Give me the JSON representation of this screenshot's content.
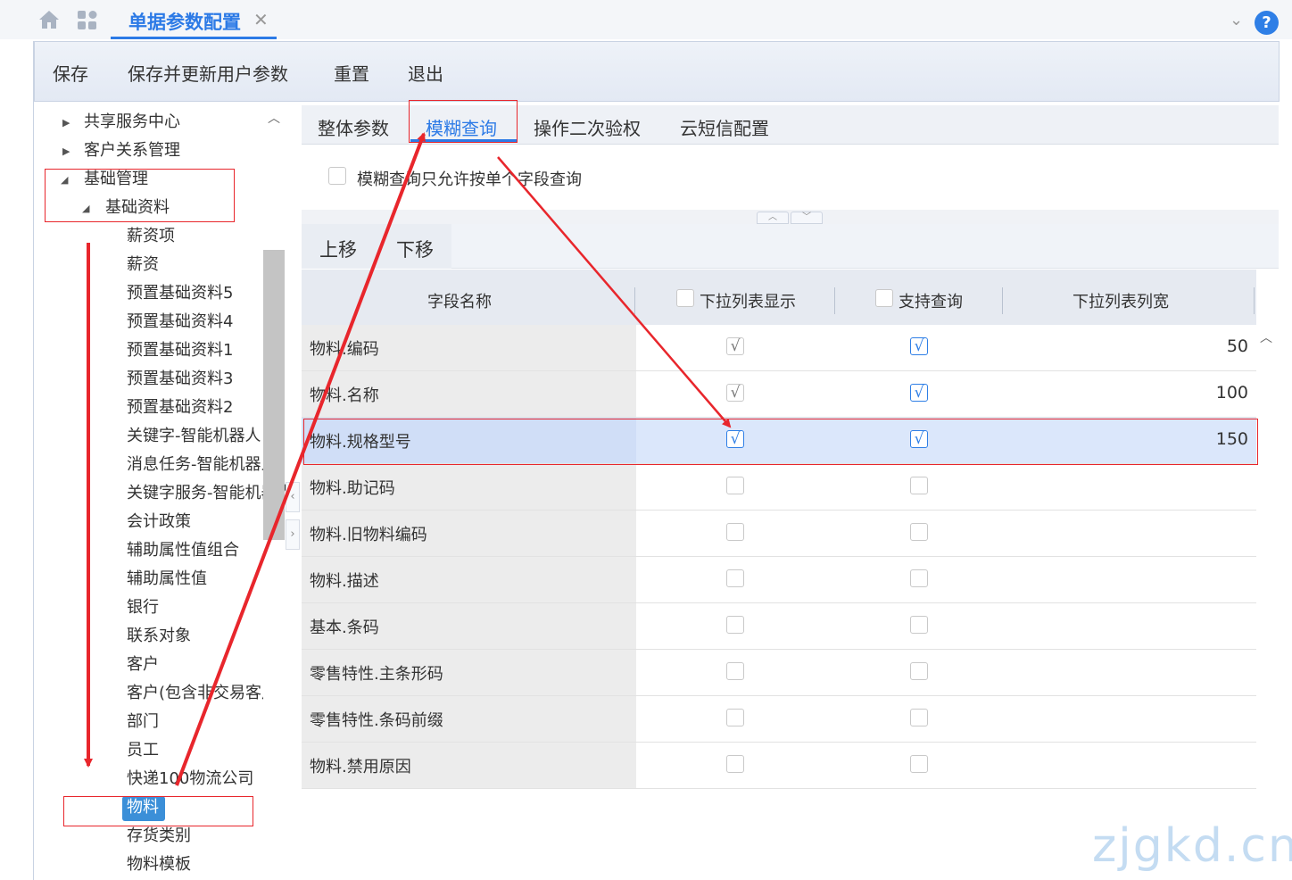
{
  "topbar": {
    "page_tab_label": "单据参数配置",
    "close_glyph": "✕",
    "collapse_glyph": "⌄",
    "help_glyph": "?"
  },
  "toolbar": {
    "save": "保存",
    "save_update": "保存并更新用户参数",
    "reset": "重置",
    "exit": "退出"
  },
  "sidebar": {
    "items": [
      {
        "label": "共享服务中心",
        "arrow": "▶"
      },
      {
        "label": "客户关系管理",
        "arrow": "▶"
      },
      {
        "label": "基础管理",
        "arrow": "◢"
      },
      {
        "label": "基础资料",
        "arrow": "◢"
      },
      {
        "label": "薪资项"
      },
      {
        "label": "薪资"
      },
      {
        "label": "预置基础资料5"
      },
      {
        "label": "预置基础资料4"
      },
      {
        "label": "预置基础资料1"
      },
      {
        "label": "预置基础资料3"
      },
      {
        "label": "预置基础资料2"
      },
      {
        "label": "关键字-智能机器人"
      },
      {
        "label": "消息任务-智能机器人"
      },
      {
        "label": "关键字服务-智能机器人"
      },
      {
        "label": "会计政策"
      },
      {
        "label": "辅助属性值组合"
      },
      {
        "label": "辅助属性值"
      },
      {
        "label": "银行"
      },
      {
        "label": "联系对象"
      },
      {
        "label": "客户"
      },
      {
        "label": "客户(包含非交易客户)"
      },
      {
        "label": "部门"
      },
      {
        "label": "员工"
      },
      {
        "label": "快递100物流公司"
      },
      {
        "label": "物料",
        "selected": true
      },
      {
        "label": "存货类别"
      },
      {
        "label": "物料模板"
      }
    ]
  },
  "tabs": [
    {
      "label": "整体参数"
    },
    {
      "label": "模糊查询",
      "active": true
    },
    {
      "label": "操作二次验权"
    },
    {
      "label": "云短信配置"
    }
  ],
  "fuzzy": {
    "single_field_label": "模糊查询只允许按单个字段查询",
    "single_field_checked": false
  },
  "move": {
    "up": "上移",
    "down": "下移"
  },
  "grid": {
    "headers": {
      "field_name": "字段名称",
      "dropdown_display": "下拉列表显示",
      "support_query": "支持查询",
      "dropdown_width": "下拉列表列宽"
    },
    "rows": [
      {
        "name": "物料.编码",
        "display": true,
        "display_locked": true,
        "query": true,
        "width": "50"
      },
      {
        "name": "物料.名称",
        "display": true,
        "display_locked": true,
        "query": true,
        "width": "100"
      },
      {
        "name": "物料.规格型号",
        "display": true,
        "display_locked": false,
        "query": true,
        "width": "150",
        "selected": true
      },
      {
        "name": "物料.助记码",
        "display": false,
        "query": false,
        "width": ""
      },
      {
        "name": "物料.旧物料编码",
        "display": false,
        "query": false,
        "width": ""
      },
      {
        "name": "物料.描述",
        "display": false,
        "query": false,
        "width": ""
      },
      {
        "name": "基本.条码",
        "display": false,
        "query": false,
        "width": ""
      },
      {
        "name": "零售特性.主条形码",
        "display": false,
        "query": false,
        "width": ""
      },
      {
        "name": "零售特性.条码前缀",
        "display": false,
        "query": false,
        "width": ""
      },
      {
        "name": "物料.禁用原因",
        "display": false,
        "query": false,
        "width": ""
      }
    ]
  },
  "check_glyph": "√",
  "watermark": "zjgkd.cn",
  "colors": {
    "accent": "#2c7ae6",
    "annotation": "#e8262c",
    "selected_row": "#dbe7fb"
  }
}
